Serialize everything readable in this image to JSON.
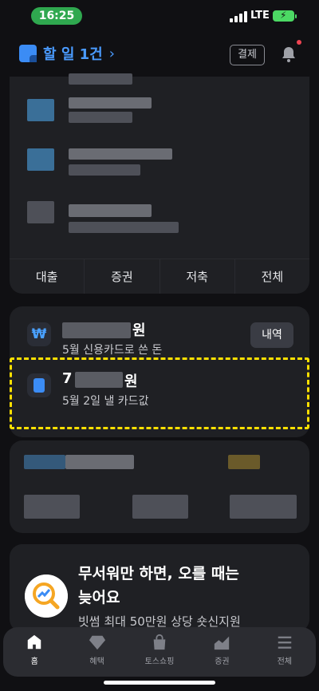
{
  "status_bar": {
    "time": "16:25",
    "network": "LTE"
  },
  "header": {
    "todo_label": "할 일 1건",
    "chevron": "›",
    "pay_label": "결제",
    "colors": {
      "accent": "#4a9bff"
    }
  },
  "quick_tabs": [
    "대출",
    "증권",
    "저축",
    "전체"
  ],
  "accounts": {
    "credit": {
      "amount_suffix": "원",
      "description": "5월 신용카드로 쓴 돈",
      "button": "내역",
      "icon": "won-icon"
    },
    "card_due": {
      "amount_prefix": "7",
      "amount_suffix": "원",
      "description": "5월 2일 낼 카드값",
      "icon": "card-icon"
    }
  },
  "promo": {
    "title_line1": "무서워만 하면, 오를 때는",
    "title_line2": "늦어요",
    "subtitle": "빗썸 최대 50만원 상당 숏신지원",
    "icon": "chart-magnifier-icon"
  },
  "tabbar": [
    {
      "label": "홈",
      "icon": "home-icon",
      "active": true
    },
    {
      "label": "혜택",
      "icon": "diamond-icon",
      "active": false
    },
    {
      "label": "토스쇼핑",
      "icon": "shopping-bag-icon",
      "active": false
    },
    {
      "label": "증권",
      "icon": "stock-chart-icon",
      "active": false
    },
    {
      "label": "전체",
      "icon": "menu-icon",
      "active": false
    }
  ]
}
